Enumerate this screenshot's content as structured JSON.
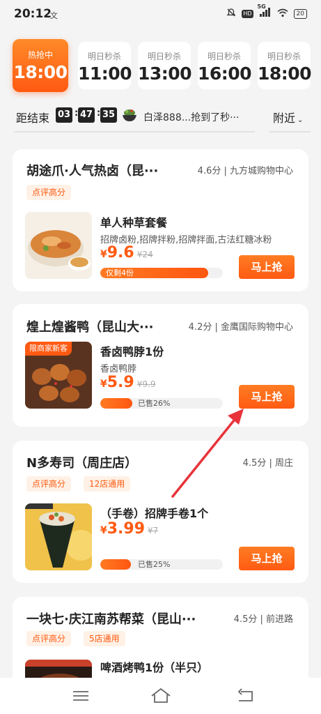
{
  "status": {
    "time": "20:12",
    "notif_glyph": "文",
    "signal_label": "5G",
    "hd": "HD",
    "battery": "20",
    "icons": [
      "mute-icon",
      "signal-icon",
      "wifi-icon",
      "battery-icon"
    ]
  },
  "slots": [
    {
      "label": "热抢中",
      "time": "18:00",
      "active": true
    },
    {
      "label": "明日秒杀",
      "time": "11:00"
    },
    {
      "label": "明日秒杀",
      "time": "13:00"
    },
    {
      "label": "明日秒杀",
      "time": "16:00"
    },
    {
      "label": "明日秒杀",
      "time": "18:00"
    }
  ],
  "countdown": {
    "label": "距结束",
    "hh": "03",
    "mm": "47",
    "ss": "35",
    "ticker": "白泽888...抢到了秒···",
    "filter": "附近"
  },
  "cards": [
    {
      "shop": "胡途爪·人气热卤（昆···",
      "meta": "4.6分 | 九方城购物中心",
      "tags": [
        "点评高分"
      ],
      "deal": "单人种草套餐",
      "desc": "招牌卤粉,招牌拌粉,招牌拌面,古法红糖冰粉",
      "yen": "¥",
      "price": "9.6",
      "orig": "¥24",
      "bar_text": "仅剩4份",
      "progress": 0.88,
      "button": "马上抢"
    },
    {
      "shop": "煌上煌酱鸭（昆山大···",
      "meta": "4.2分 | 金鹰国际购物中心",
      "badge": "限商家新客",
      "deal": "香卤鸭脖1份",
      "desc": "香卤鸭脖",
      "yen": "¥",
      "price": "5.9",
      "orig": "¥9.9",
      "bar_text": "已售26%",
      "progress": 0.26,
      "button": "马上抢"
    },
    {
      "shop": "N多寿司（周庄店）",
      "meta": "4.5分 | 周庄",
      "tags": [
        "点评高分",
        "12店通用"
      ],
      "deal": "（手卷）招牌手卷1个",
      "yen": "¥",
      "price": "3.99",
      "orig": "¥7",
      "bar_text": "已售25%",
      "progress": 0.25,
      "button": "马上抢"
    },
    {
      "shop": "一块七·庆江南苏帮菜（昆山···",
      "meta": "4.5分 | 前进路",
      "tags": [
        "点评高分",
        "5店通用"
      ],
      "deal": "啤酒烤鸭1份（半只）"
    }
  ],
  "nav": [
    "menu-icon",
    "home-icon",
    "back-icon"
  ],
  "colors": {
    "accent": "#ff5a12",
    "tag_bg": "#fff1e6",
    "arrow": "#e8333a"
  }
}
